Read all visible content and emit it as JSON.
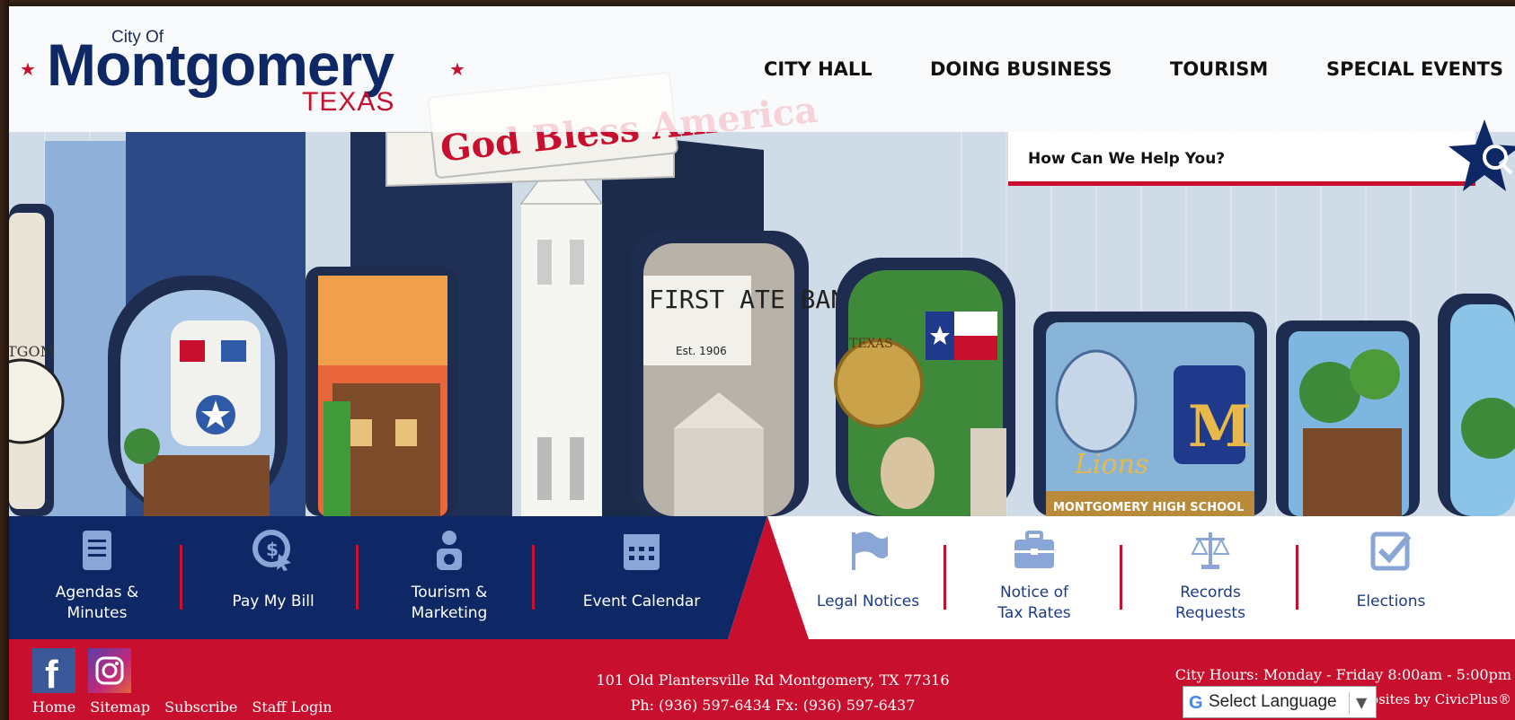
{
  "site": {
    "logo": {
      "city_of": "City Of",
      "name": "Montgomery",
      "state": "TEXAS"
    }
  },
  "nav": {
    "items": [
      {
        "label": "CITY HALL"
      },
      {
        "label": "DOING BUSINESS"
      },
      {
        "label": "TOURISM"
      },
      {
        "label": "SPECIAL EVENTS"
      }
    ]
  },
  "search": {
    "placeholder": "How Can We Help You?",
    "icon": "search-icon"
  },
  "hero": {
    "banner_text": "God Bless America",
    "bank_sign": "FIRST ATE BANK",
    "bank_est": "Est. 1906",
    "texas_seal": "TEXAS",
    "school_text": "MONTGOMERY HIGH SCHOOL",
    "mascot_text": "Lions",
    "clock_text": "TGOM"
  },
  "quick_links": {
    "items": [
      {
        "label": "Agendas & Minutes",
        "icon": "document-icon"
      },
      {
        "label": "Pay My Bill",
        "icon": "pay-bill-icon"
      },
      {
        "label": "Tourism & Marketing",
        "icon": "person-icon"
      },
      {
        "label": "Event Calendar",
        "icon": "calendar-icon"
      },
      {
        "label": "Legal Notices",
        "icon": "flag-icon"
      },
      {
        "label": "Notice of Tax Rates",
        "icon": "briefcase-icon"
      },
      {
        "label": "Records Requests",
        "icon": "scales-icon"
      },
      {
        "label": "Elections",
        "icon": "checkbox-icon"
      }
    ],
    "colors": {
      "dark": "#0e2866",
      "accent": "#c8102e",
      "light_icon": "#8aa6d6"
    }
  },
  "footer": {
    "social": [
      {
        "name": "facebook-icon"
      },
      {
        "name": "instagram-icon"
      }
    ],
    "links": [
      {
        "label": "Home"
      },
      {
        "label": "Sitemap"
      },
      {
        "label": "Subscribe"
      },
      {
        "label": "Staff Login"
      }
    ],
    "address": "101 Old Plantersville Rd   Montgomery, TX 77316",
    "phone": "Ph: (936) 597-6434 Fx: (936) 597-6437",
    "hours": "City Hours: Monday - Friday 8:00am - 5:00pm",
    "credit": "Government Websites by CivicPlus®",
    "language": {
      "label": "Select Language"
    }
  }
}
